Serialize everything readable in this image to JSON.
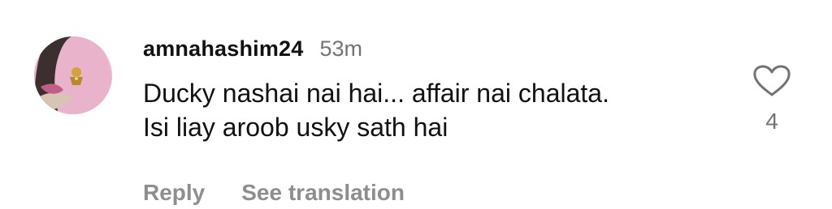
{
  "comment": {
    "username": "amnahashim24",
    "time": "53m",
    "text_lines": [
      "Ducky nashai nai hai... affair nai chalata.",
      "Isi liay aroob usky sath hai"
    ],
    "like_count": "4",
    "actions": {
      "reply": "Reply",
      "see_translation": "See translation"
    },
    "icons": {
      "avatar": "avatar-photo",
      "like": "heart-outline-icon"
    },
    "colors": {
      "text": "#111111",
      "secondary": "#737373",
      "action": "#8e8e8e"
    }
  }
}
